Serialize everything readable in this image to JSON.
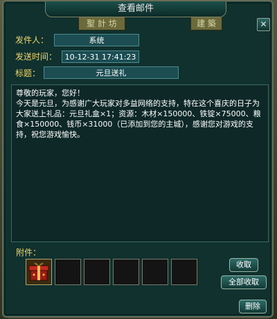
{
  "window": {
    "title": "查看邮件",
    "close_glyph": "✕",
    "background_signs": [
      "聖 計 坊",
      "建 築"
    ]
  },
  "mail": {
    "sender_label": "发件人：",
    "sender_value": "系统",
    "time_label": "发送时间：",
    "time_value": "10-12-31  17:41:23",
    "subject_label": "标题：",
    "subject_value": "元旦送礼",
    "body": "尊敬的玩家，您好！\n今天是元旦，为感谢广大玩家对多益网络的支持，特在这个喜庆的日子为大家送上礼品：元旦礼盒×1；资源：木材×150000、铁锭×75000、粮食×150000、钱币×31000（已添加到您的主城），感谢您对游戏的支持，祝您游戏愉快。"
  },
  "attachments": {
    "label": "附件：",
    "slots": [
      {
        "item": "gift-box",
        "icon": "gift-box-icon"
      },
      {
        "item": ""
      },
      {
        "item": ""
      },
      {
        "item": ""
      },
      {
        "item": ""
      },
      {
        "item": ""
      }
    ]
  },
  "buttons": {
    "collect": "收取",
    "collect_all": "全部收取",
    "delete": "删除"
  },
  "colors": {
    "label": "#f0d56a",
    "panel": "#10312e",
    "field": "#1b4d52"
  }
}
